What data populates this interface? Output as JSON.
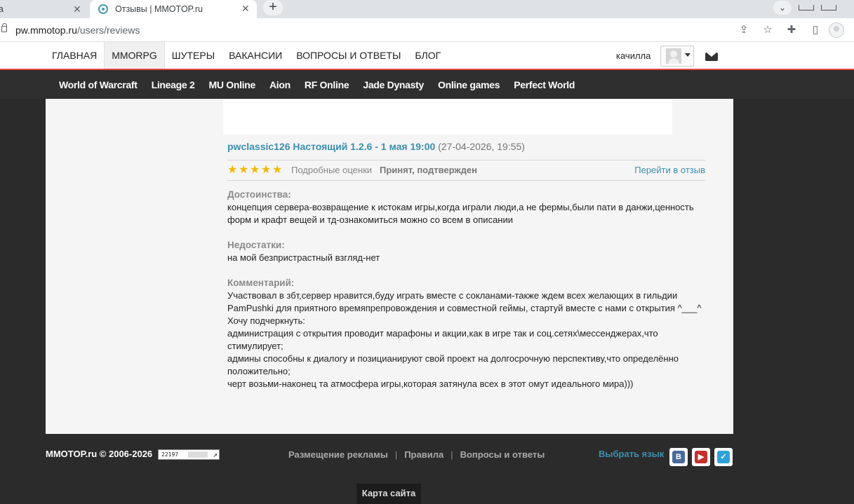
{
  "browser": {
    "prev_tab_title": "а",
    "active_tab_title": "Отзывы | MMOTOP.ru",
    "url_host": "pw.mmotop.ru",
    "url_path": "/users/reviews"
  },
  "mainnav": [
    "ГЛАВНАЯ",
    "MMORPG",
    "ШУТЕРЫ",
    "ВАКАНСИИ",
    "ВОПРОСЫ И ОТВЕТЫ",
    "БЛОГ"
  ],
  "user": {
    "name": "качилла"
  },
  "gamesnav": [
    "World of Warcraft",
    "Lineage 2",
    "MU Online",
    "Aion",
    "RF Online",
    "Jade Dynasty",
    "Online games",
    "Perfect World"
  ],
  "review": {
    "title": "pwclassic126 Настоящий 1.2.6 - 1 мая 19:00",
    "date": "(27-04-2026, 19:55)",
    "rating": 5,
    "detailed_label": "Подробные оценки",
    "status": "Принят, подтвержден",
    "goto_label": "Перейти в отзыв",
    "pros_label": "Достоинства:",
    "pros": "концепция сервера-возвращение к истокам игры,когда играли люди,а не фермы,были пати в данжи,ценность форм и крафт вещей и тд-ознакомиться можно со всем в описании",
    "cons_label": "Недостатки:",
    "cons": "на мой безпристрастный взгляд-нет",
    "comment_label": "Комментарий:",
    "comment": "Участвовал в збт,сервер нравится,буду играть вместе с сокланами-также ждем всех желающих в гильдии PamPushki для приятного времяпрепровождения и совместной геймы, стартуй вместе с нами с открытия ^___^\nХочу подчеркнуть:\nадминистрация с открытия проводит марафоны и акции,как в игре так и соц.сетях\\мессенджерах,что стимулирует;\nадмины способны к диалогу и позицианируют свой проект на долгосрочную перспективу,что определённо положительно;\nчерт возьми-наконец та атмосфера игры,которая затянула всех в этот омут идеального мира)))"
  },
  "footer": {
    "copyright": "MMOTOP.ru © 2006-2026",
    "counter": "22197",
    "links": [
      "Размещение рекламы",
      "Правила",
      "Вопросы и ответы"
    ],
    "lang_label": "Выбрать язык",
    "sitemap": "Карта сайта"
  },
  "colors": {
    "accent": "#3b8fae",
    "header_border": "#e0443a",
    "star": "#f2b800"
  }
}
